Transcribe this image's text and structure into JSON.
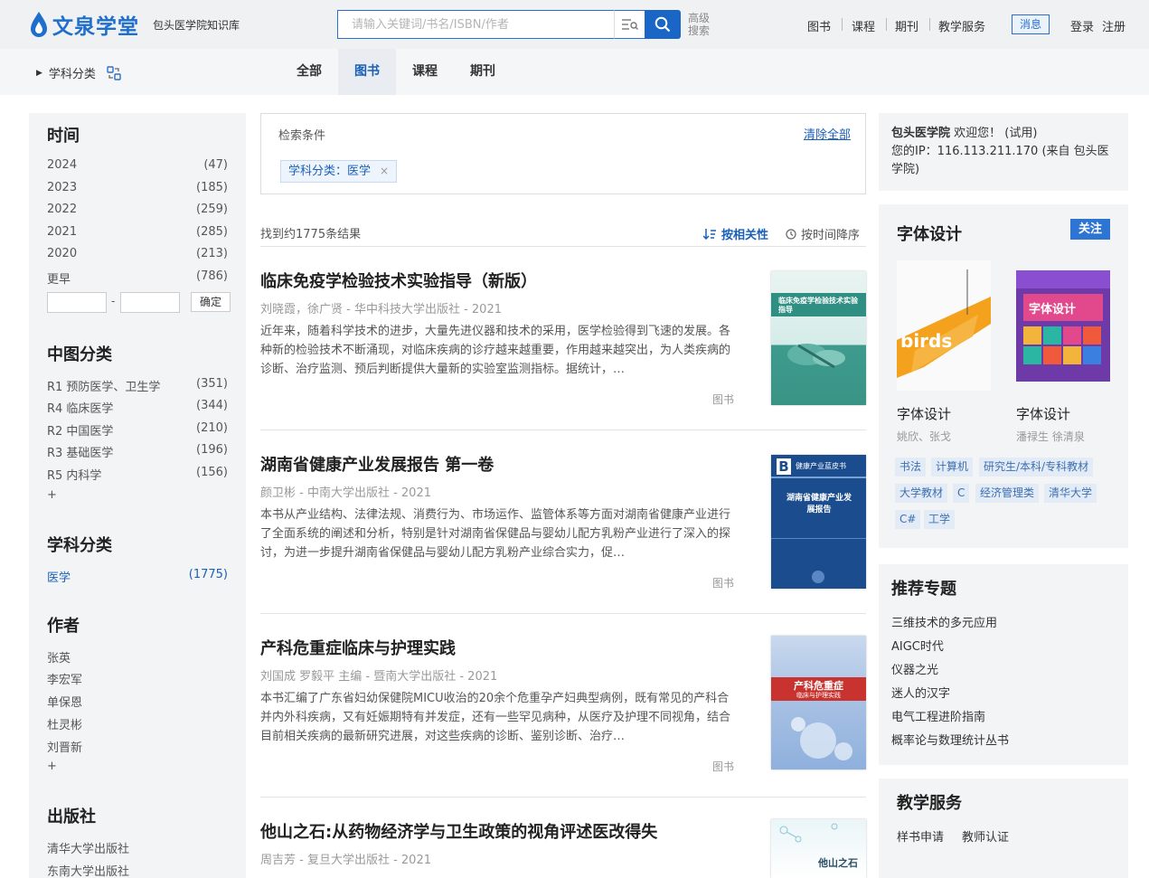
{
  "header": {
    "logo_text": "文泉学堂",
    "logo_sub": "包头医学院知识库",
    "search_placeholder": "请输入关键词/书名/ISBN/作者",
    "advanced_search": "高级搜索",
    "nav": [
      "图书",
      "课程",
      "期刊",
      "教学服务"
    ],
    "message": "消息",
    "login": "登录",
    "register": "注册",
    "accent": "#1a66c7"
  },
  "subbar": {
    "subject_label": "学科分类",
    "tabs": [
      "全部",
      "图书",
      "课程",
      "期刊"
    ],
    "active_tab": "图书"
  },
  "sidebar": {
    "time": {
      "title": "时间",
      "items": [
        {
          "label": "2024",
          "count": "(47)"
        },
        {
          "label": "2023",
          "count": "(185)"
        },
        {
          "label": "2022",
          "count": "(259)"
        },
        {
          "label": "2021",
          "count": "(285)"
        },
        {
          "label": "2020",
          "count": "(213)"
        },
        {
          "label": "更早",
          "count": "(786)"
        }
      ],
      "range_dash": "-",
      "confirm": "确定"
    },
    "clc": {
      "title": "中图分类",
      "items": [
        {
          "label": "R1 预防医学、卫生学",
          "count": "(351)"
        },
        {
          "label": "R4 临床医学",
          "count": "(344)"
        },
        {
          "label": "R2 中国医学",
          "count": "(210)"
        },
        {
          "label": "R3 基础医学",
          "count": "(196)"
        },
        {
          "label": "R5 内科学",
          "count": "(156)"
        }
      ],
      "more": "+"
    },
    "subject": {
      "title": "学科分类",
      "items": [
        {
          "label": "医学",
          "count": "(1775)"
        }
      ]
    },
    "author": {
      "title": "作者",
      "items": [
        "张英",
        "李宏军",
        "单保恩",
        "杜灵彬",
        "刘晋新"
      ],
      "more": "+"
    },
    "publisher": {
      "title": "出版社",
      "items": [
        "清华大学出版社",
        "东南大学出版社"
      ]
    }
  },
  "criteria": {
    "label": "检索条件",
    "clear": "清除全部",
    "chip": "学科分类：医学",
    "chip_close": "×"
  },
  "results": {
    "count": "找到约1775条结果",
    "sort_relevance": "按相关性",
    "sort_time": "按时间降序",
    "items": [
      {
        "title": "临床免疫学检验技术实验指导（新版）",
        "meta": "刘晓霞，徐广贤 - 华中科技大学出版社 - 2021",
        "desc": "近年来，随着科学技术的进步，大量先进仪器和技术的采用，医学检验得到飞速的发展。各种新的检验技术不断涌现，对临床疾病的诊疗越来越重要，作用越来越突出，为人类疾病的诊断、治疗监测、预后判断提供大量新的实验室监测指标。据统计，…",
        "type": "图书",
        "cover_title": "临床免疫学检验技术实验指导"
      },
      {
        "title": "湖南省健康产业发展报告 第一卷",
        "meta": "颜卫彬 - 中南大学出版社 - 2021",
        "desc": "本书从产业结构、法律法规、消费行为、市场运作、监管体系等方面对湖南省健康产业进行了全面系统的阐述和分析，特别是针对湖南省保健品与婴幼儿配方乳粉产业进行了深入的探讨，为进一步提升湖南省保健品与婴幼儿配方乳粉产业综合实力，促…",
        "type": "图书",
        "cover_series": "健康产业蓝皮书",
        "cover_title": "湖南省健康产业发展报告"
      },
      {
        "title": "产科危重症临床与护理实践",
        "meta": "刘国成 罗毅平 主编 - 暨南大学出版社 - 2021",
        "desc": "本书汇编了广东省妇幼保健院MICU收治的20余个危重孕产妇典型病例，既有常见的产科合并内外科疾病，又有妊娠期特有并发症，还有一些罕见病种，从医疗及护理不同视角，结合目前相关疾病的最新研究进展，对这些疾病的诊断、鉴别诊断、治疗…",
        "type": "图书",
        "cover_title": "产科危重症",
        "cover_sub": "临床与护理实践"
      },
      {
        "title": "他山之石:从药物经济学与卫生政策的视角评述医改得失",
        "meta": "周吉芳 - 复旦大学出版社 - 2021",
        "desc": "",
        "type": "图书",
        "cover_title": "他山之石"
      }
    ]
  },
  "right": {
    "user": {
      "line1_bold": "包头医学院",
      "line1_rest": " 欢迎您！ (试用)",
      "line2": "您的IP：116.113.211.170 (来自 包头医学院)"
    },
    "font_design": {
      "title": "字体设计",
      "follow": "关注",
      "books": [
        {
          "name": "字体设计",
          "author": "姚欣、张戈"
        },
        {
          "name": "字体设计",
          "author": "潘禄生 徐清泉"
        }
      ],
      "tags": [
        "书法",
        "计算机",
        "研究生/本科/专科教材",
        "大学教材",
        "C",
        "经济管理类",
        "清华大学",
        "C#",
        "工学"
      ]
    },
    "topics": {
      "title": "推荐专题",
      "items": [
        "三维技术的多元应用",
        "AIGC时代",
        "仪器之光",
        "迷人的汉字",
        "电气工程进阶指南",
        "概率论与数理统计丛书"
      ]
    },
    "service": {
      "title": "教学服务",
      "items": [
        "样书申请",
        "教师认证"
      ]
    }
  }
}
